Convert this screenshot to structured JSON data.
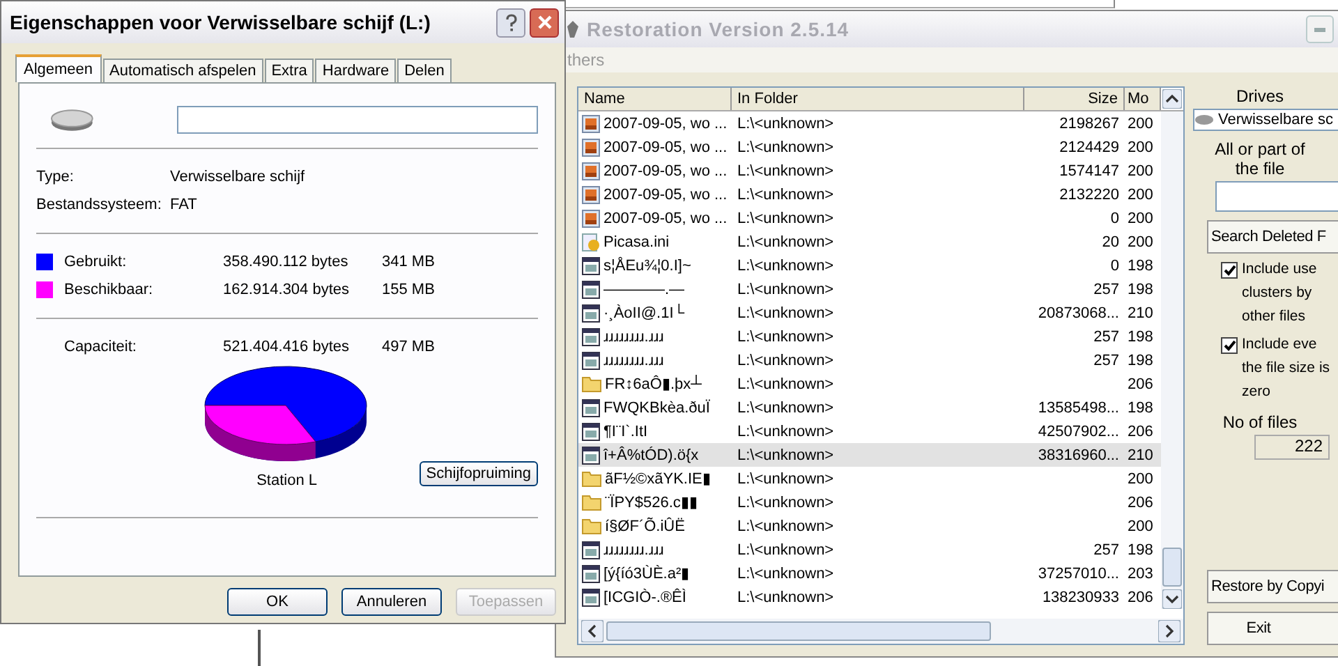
{
  "properties": {
    "title": "Eigenschappen voor Verwisselbare schijf (L:)",
    "tabs": [
      {
        "label": "Algemeen",
        "selected": true
      },
      {
        "label": "Automatisch afspelen",
        "selected": false
      },
      {
        "label": "Extra",
        "selected": false
      },
      {
        "label": "Hardware",
        "selected": false
      },
      {
        "label": "Delen",
        "selected": false
      }
    ],
    "type_label": "Type:",
    "type_value": "Verwisselbare schijf",
    "fs_label": "Bestandssysteem:",
    "fs_value": "FAT",
    "space": [
      {
        "label": "Gebruikt:",
        "bytes": "358.490.112 bytes",
        "mb": "341 MB",
        "color": "#0000ff"
      },
      {
        "label": "Beschikbaar:",
        "bytes": "162.914.304 bytes",
        "mb": "155 MB",
        "color": "#ff00ff"
      }
    ],
    "capacity": {
      "label": "Capaciteit:",
      "bytes": "521.404.416 bytes",
      "mb": "497 MB"
    },
    "drive_label": "Station L",
    "cleanup_button": "Schijfopruiming",
    "buttons": [
      {
        "label": "OK",
        "disabled": false
      },
      {
        "label": "Annuleren",
        "disabled": false
      },
      {
        "label": "Toepassen",
        "disabled": true
      }
    ]
  },
  "restoration": {
    "title": "Restoration Version 2.5.14",
    "menu": "thers",
    "columns": [
      "Name",
      "In Folder",
      "Size",
      "Mo"
    ],
    "rows": [
      {
        "kind": "image",
        "name": "2007-09-05, wo ...",
        "folder": "L:\\<unknown>",
        "size": "2198267",
        "mod": "200",
        "selected": false
      },
      {
        "kind": "image",
        "name": "2007-09-05, wo ...",
        "folder": "L:\\<unknown>",
        "size": "2124429",
        "mod": "200",
        "selected": false
      },
      {
        "kind": "image",
        "name": "2007-09-05, wo ...",
        "folder": "L:\\<unknown>",
        "size": "1574147",
        "mod": "200",
        "selected": false
      },
      {
        "kind": "image",
        "name": "2007-09-05, wo ...",
        "folder": "L:\\<unknown>",
        "size": "2132220",
        "mod": "200",
        "selected": false
      },
      {
        "kind": "image",
        "name": "2007-09-05, wo ...",
        "folder": "L:\\<unknown>",
        "size": "0",
        "mod": "200",
        "selected": false
      },
      {
        "kind": "ini",
        "name": "Picasa.ini",
        "folder": "L:\\<unknown>",
        "size": "20",
        "mod": "200",
        "selected": false
      },
      {
        "kind": "file",
        "name": "s¦ÅEu¾¦0.Ι]~",
        "folder": "L:\\<unknown>",
        "size": "0",
        "mod": "198",
        "selected": false
      },
      {
        "kind": "file",
        "name": "————.—",
        "folder": "L:\\<unknown>",
        "size": "257",
        "mod": "198",
        "selected": false
      },
      {
        "kind": "file",
        "name": "·¸ÀoΙΙ@.1Ι└",
        "folder": "L:\\<unknown>",
        "size": "20873068...",
        "mod": "210",
        "selected": false
      },
      {
        "kind": "file",
        "name": "ɹɹɹɹɹɹɹɹ.ɹɹɹ",
        "folder": "L:\\<unknown>",
        "size": "257",
        "mod": "198",
        "selected": false
      },
      {
        "kind": "file",
        "name": "ɹɹɹɹɹɹɹɹ.ɹɹɹ",
        "folder": "L:\\<unknown>",
        "size": "257",
        "mod": "198",
        "selected": false
      },
      {
        "kind": "folder",
        "name": "FR↕6aÔ▮.þx┴",
        "folder": "L:\\<unknown>",
        "mod": "206",
        "selected": false
      },
      {
        "kind": "file",
        "name": "FWQKBkèa.ðuÏ",
        "folder": "L:\\<unknown>",
        "size": "13585498...",
        "mod": "198",
        "selected": false
      },
      {
        "kind": "file",
        "name": "¶Ι¨Ι`.ΙtΙ",
        "folder": "L:\\<unknown>",
        "size": "42507902...",
        "mod": "206",
        "selected": false
      },
      {
        "kind": "file",
        "name": "î+Â%tÓD).ö{x",
        "folder": "L:\\<unknown>",
        "size": "38316960...",
        "mod": "210",
        "selected": true
      },
      {
        "kind": "folder",
        "name": "ãF½©xãYK.IE▮",
        "folder": "L:\\<unknown>",
        "mod": "200",
        "selected": false
      },
      {
        "kind": "folder",
        "name": "¨ÏPY$526.c▮▮",
        "folder": "L:\\<unknown>",
        "mod": "206",
        "selected": false
      },
      {
        "kind": "folder",
        "name": "í§ØF´Õ.iÛË",
        "folder": "L:\\<unknown>",
        "mod": "200",
        "selected": false
      },
      {
        "kind": "file",
        "name": "ɹɹɹɹɹɹɹɹ.ɹɹɹ",
        "folder": "L:\\<unknown>",
        "size": "257",
        "mod": "198",
        "selected": false
      },
      {
        "kind": "file",
        "name": "[ý{íó3ÙÈ.a²▮",
        "folder": "L:\\<unknown>",
        "size": "37257010...",
        "mod": "203",
        "selected": false
      },
      {
        "kind": "file",
        "name": "[ΙCGΙÒ-.®ÊÌ",
        "folder": "L:\\<unknown>",
        "size": "138230933",
        "mod": "206",
        "selected": false
      }
    ],
    "drives_label": "Drives",
    "drive_value": "Verwisselbare sc",
    "search_label": "All or part of\nthe file",
    "search_button": "Search Deleted F",
    "options": [
      {
        "label": "Include use\nclusters by\nother files",
        "checked": true
      },
      {
        "label": "Include eve\nthe file size is\nzero",
        "checked": true
      }
    ],
    "count_label": "No of files",
    "count": "222",
    "restore_button": "Restore by Copyi",
    "exit_button": "Exit"
  }
}
